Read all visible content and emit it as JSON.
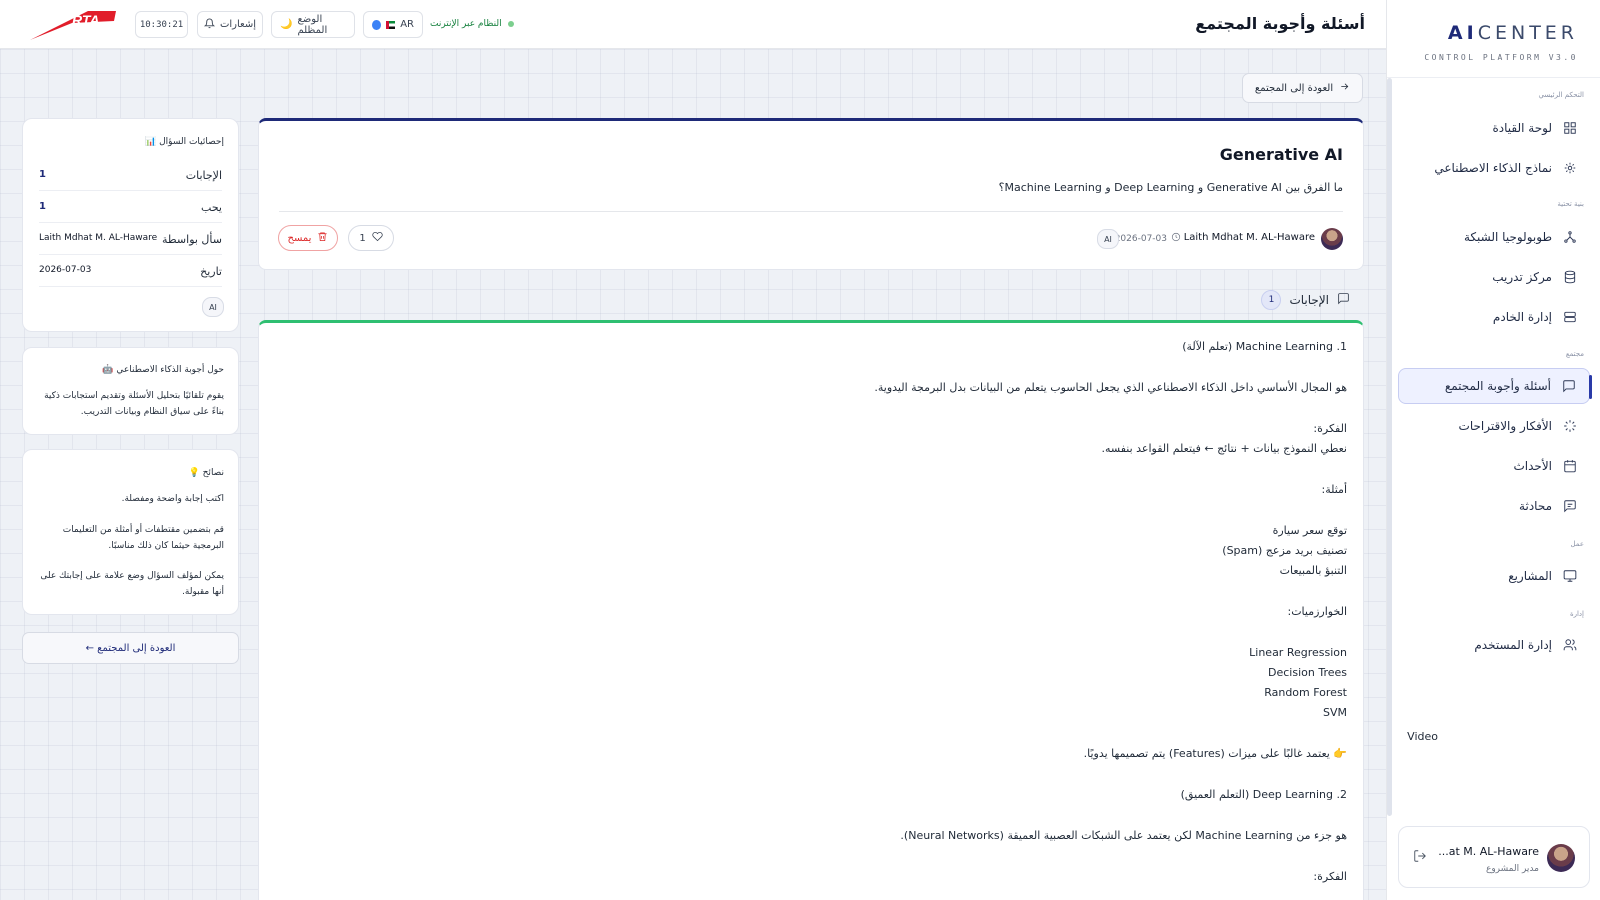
{
  "brand": {
    "title_bold": "AI",
    "title_rest": "CENTER",
    "subtitle": "CONTROL PLATFORM V3.0"
  },
  "sidebar": {
    "sections": {
      "main": "التحكم الرئيسي",
      "infra": "بنية تحتية",
      "community": "مجتمع",
      "work": "عمل",
      "admin": "إدارة"
    },
    "items": [
      {
        "label": "لوحة القيادة",
        "icon": "grid-icon"
      },
      {
        "label": "نماذج الذكاء الاصطناعي",
        "icon": "cpu-icon"
      },
      {
        "label": "طوبولوجيا الشبكة",
        "icon": "network-icon"
      },
      {
        "label": "مركز تدريب",
        "icon": "database-icon"
      },
      {
        "label": "إدارة الخادم",
        "icon": "server-icon"
      },
      {
        "label": "أسئلة وأجوبة المجتمع",
        "icon": "message-square-icon"
      },
      {
        "label": "الأفكار والاقتراحات",
        "icon": "loader-icon"
      },
      {
        "label": "الأحداث",
        "icon": "calendar-icon"
      },
      {
        "label": "محادثة",
        "icon": "chat-icon"
      },
      {
        "label": "المشاريع",
        "icon": "monitor-icon"
      },
      {
        "label": "إدارة المستخدم",
        "icon": "users-icon"
      }
    ],
    "video": "Video",
    "user": {
      "name": "...at M. AL-Haware",
      "role": "مدير المشروع"
    }
  },
  "header": {
    "title": "أسئلة وأجوبة المجتمع",
    "status": "النظام عبر الإنترنت",
    "lang": "AR",
    "dark_mode": "الوضع المظلم",
    "notifications": "إشعارات",
    "time": "10:30:21",
    "logo": "RTA"
  },
  "back_label": "العودة إلى المجتمع",
  "question": {
    "title": "Generative AI",
    "body": "ما الفرق بين Generative AI و Deep Learning و Machine Learning؟",
    "author": "Laith Mdhat M. AL-Haware",
    "date": "2026-07-03",
    "tag": "AI",
    "likes": "1",
    "delete": "يمسح"
  },
  "answers": {
    "label": "الإجابات",
    "count": "1",
    "lines": [
      "1. Machine Learning (تعلم الآلة)",
      "هو المجال الأساسي داخل الذكاء الاصطناعي الذي يجعل الحاسوب يتعلم من البيانات بدل البرمجة اليدوية.",
      "الفكرة:",
      "نعطي النموذج بيانات + نتائج ← فيتعلم القواعد بنفسه.",
      "أمثلة:",
      "توقع سعر سيارة",
      "تصنيف بريد مزعج (Spam)",
      "التنبؤ بالمبيعات",
      "الخوارزميات:",
      "Linear Regression",
      "Decision Trees",
      "Random Forest",
      "SVM",
      "👉 يعتمد غالبًا على ميزات (Features) يتم تصميمها يدويًا.",
      "2. Deep Learning (التعلم العميق)",
      "هو جزء من Machine Learning لكن يعتمد على الشبكات العصبية العميقة (Neural Networks).",
      "الفكرة:"
    ]
  },
  "stats": {
    "title": "📊 إحصائيات السؤال",
    "rows": [
      {
        "k": "الإجابات",
        "v": "1"
      },
      {
        "k": "يحب",
        "v": "1"
      },
      {
        "k": "سأل بواسطة",
        "v": "Laith Mdhat M. AL-Haware"
      },
      {
        "k": "تاريخ",
        "v": "2026-07-03"
      }
    ],
    "tag": "AI"
  },
  "about": {
    "title": "🤖 حول أجوبة الذكاء الاصطناعي",
    "text": "يقوم تلقائيًا بتحليل الأسئلة وتقديم استجابات ذكية بناءً على سياق النظام وبيانات التدريب."
  },
  "tips": {
    "title": "💡 نصائح",
    "items": [
      "اكتب إجابة واضحة ومفصلة.",
      "قم بتضمين مقتطفات أو أمثلة من التعليمات البرمجية حيثما كان ذلك مناسبًا.",
      "يمكن لمؤلف السؤال وضع علامة على إجابتك على أنها مقبولة."
    ]
  },
  "back_bottom": "← العودة إلى المجتمع"
}
